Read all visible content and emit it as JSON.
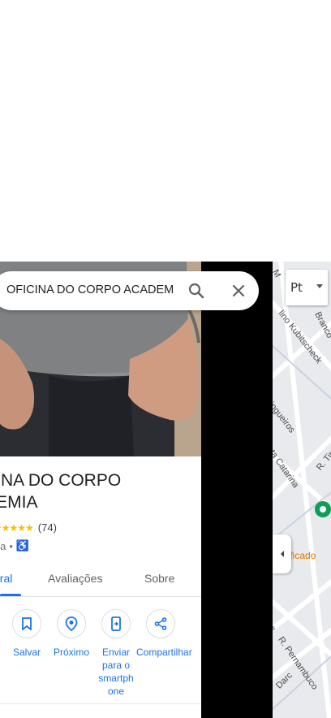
{
  "search": {
    "query": "OFICINA DO CORPO ACADEM"
  },
  "place": {
    "title_line1": "CINA DO CORPO",
    "title_line2": "DEMIA",
    "rating_count": "(74)",
    "category": "nia",
    "separator": "•"
  },
  "tabs": [
    {
      "label": "eral"
    },
    {
      "label": "Avaliações"
    },
    {
      "label": "Sobre"
    }
  ],
  "actions": [
    {
      "label": "Salvar",
      "icon": "bookmark-icon"
    },
    {
      "label": "Próximo",
      "icon": "nearby-icon"
    },
    {
      "label": "Enviar para o smartph one",
      "icon": "send-to-phone-icon"
    },
    {
      "label": "Compartilhar",
      "icon": "share-icon"
    }
  ],
  "map": {
    "layers_label": "Pt",
    "streets": [
      "M",
      "Branco",
      "lino Kubitscheck",
      "ringueiros",
      "nta Catarina",
      "R. Tir",
      "R. Pernambuco",
      "ll",
      "Darc"
    ],
    "poi_label": "nificado"
  },
  "colors": {
    "accent": "#1a73e8",
    "star": "#fbbc04",
    "poi": "#e37400",
    "poi_pin": "#0f9d58"
  }
}
